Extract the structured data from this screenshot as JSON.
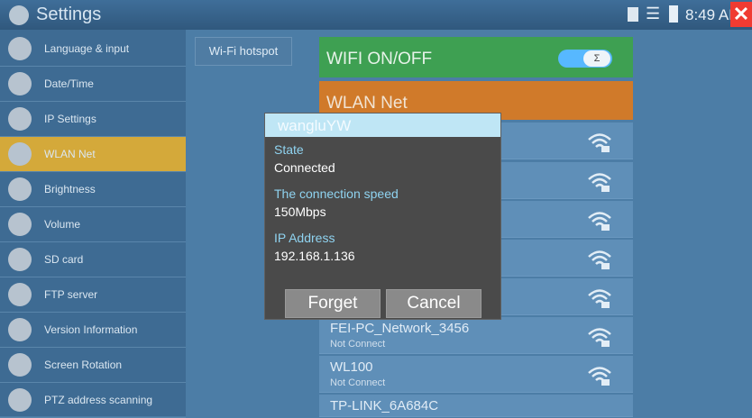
{
  "statusbar": {
    "title": "Settings",
    "time": "8:49 AM",
    "app_icon": "settings-gear-icon",
    "wifi_icon": "wifi-signal-icon",
    "battery_icon": "battery-icon",
    "close_icon": "close-icon"
  },
  "sidebar": {
    "items": [
      {
        "label": "Language & input",
        "icon": "language-icon"
      },
      {
        "label": "Date/Time",
        "icon": "calendar-icon"
      },
      {
        "label": "IP Settings",
        "icon": "globe-icon"
      },
      {
        "label": "WLAN Net",
        "icon": "wlan-icon",
        "active": true
      },
      {
        "label": "Brightness",
        "icon": "brightness-icon"
      },
      {
        "label": "Volume",
        "icon": "volume-icon"
      },
      {
        "label": "SD card",
        "icon": "sd-card-icon"
      },
      {
        "label": "FTP server",
        "icon": "ftp-icon"
      },
      {
        "label": "Version Information",
        "icon": "info-icon"
      },
      {
        "label": "Screen Rotation",
        "icon": "rotate-icon"
      },
      {
        "label": "PTZ address scanning",
        "icon": "ptz-icon"
      }
    ],
    "active_color": "#d4a93a"
  },
  "main": {
    "hotspot_tab": "Wi-Fi hotspot",
    "wifi_toggle_label": "WIFI ON/OFF",
    "wifi_toggle_on": true,
    "wlan_header": "WLAN Net",
    "networks": [
      {
        "name": "FEI-PC_Network_3456",
        "status": "Not Connect"
      },
      {
        "name": "WL100",
        "status": "Not Connect"
      },
      {
        "name": "TP-LINK_6A684C",
        "status": ""
      }
    ]
  },
  "dialog": {
    "title": "wangluYW",
    "state_label": "State",
    "state_value": "Connected",
    "speed_label": "The connection speed",
    "speed_value": "150Mbps",
    "ip_label": "IP Address",
    "ip_value": "192.168.1.136",
    "forget_label": "Forget",
    "cancel_label": "Cancel"
  },
  "colors": {
    "wifi_row": "#3ea052",
    "wlan_header": "#d07a2a",
    "dialog_label": "#8fd3f0"
  }
}
